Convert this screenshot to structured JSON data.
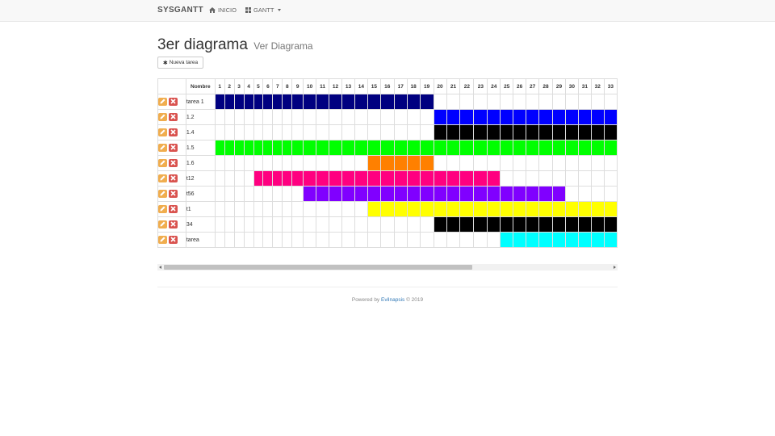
{
  "navbar": {
    "brand": "SYSGANTT",
    "home_label": "INICIO",
    "home_icon": "home-icon",
    "gantt_label": "GANTT",
    "gantt_icon": "grid-icon"
  },
  "page": {
    "title": "3er diagrama",
    "subtitle": "Ver Diagrama",
    "new_task_label": "Nueva tarea",
    "new_task_icon": "asterisk-icon"
  },
  "gantt": {
    "name_header": "Nombre",
    "days": [
      1,
      2,
      3,
      4,
      5,
      6,
      7,
      8,
      9,
      10,
      11,
      12,
      13,
      14,
      15,
      16,
      17,
      18,
      19,
      20,
      21,
      22,
      23,
      24,
      25,
      26,
      27,
      28,
      29,
      30,
      31,
      32,
      33
    ],
    "edit_icon": "pencil-icon",
    "delete_icon": "close-icon",
    "tasks": [
      {
        "name": "tarea 1",
        "start": 1,
        "end": 19,
        "color": "#000080"
      },
      {
        "name": "1.2",
        "start": 20,
        "end": 33,
        "color": "#0000ff"
      },
      {
        "name": "1.4",
        "start": 20,
        "end": 33,
        "color": "#000000"
      },
      {
        "name": "1.5",
        "start": 1,
        "end": 33,
        "color": "#00ff00"
      },
      {
        "name": "1.6",
        "start": 15,
        "end": 19,
        "color": "#ff8000"
      },
      {
        "name": "t12",
        "start": 5,
        "end": 24,
        "color": "#ff0080"
      },
      {
        "name": "t56",
        "start": 10,
        "end": 29,
        "color": "#8000ff"
      },
      {
        "name": "t1",
        "start": 15,
        "end": 33,
        "color": "#ffff00"
      },
      {
        "name": "34",
        "start": 20,
        "end": 33,
        "color": "#000000"
      },
      {
        "name": "tarea",
        "start": 25,
        "end": 33,
        "color": "#00ffff"
      }
    ]
  },
  "footer": {
    "prefix": "Powered by",
    "link": "Evilnapsis",
    "suffix": "© 2019"
  }
}
